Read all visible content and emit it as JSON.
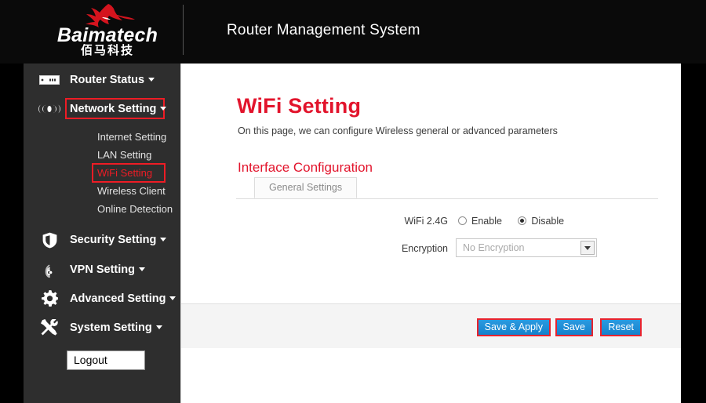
{
  "header": {
    "logo_word": "Baimatech",
    "logo_cn": "佰马科技",
    "logo_icon": "horse-head-icon",
    "title": "Router Management System"
  },
  "sidebar": {
    "groups": [
      {
        "label": "Router Status",
        "icon": "router-device-icon",
        "highlighted": false,
        "has_caret": true
      },
      {
        "label": "Network Setting",
        "icon": "broadcast-signal-icon",
        "highlighted": true,
        "has_caret": true
      },
      {
        "label": "Security Setting",
        "icon": "shield-icon",
        "highlighted": false,
        "has_caret": true
      },
      {
        "label": "VPN Setting",
        "icon": "wifi-waves-icon",
        "highlighted": false,
        "has_caret": true
      },
      {
        "label": "Advanced Setting",
        "icon": "gear-icon",
        "highlighted": false,
        "has_caret": true
      },
      {
        "label": "System Setting",
        "icon": "tools-icon",
        "highlighted": false,
        "has_caret": true
      }
    ],
    "network_submenu": [
      {
        "label": "Internet Setting",
        "active": false
      },
      {
        "label": "LAN Setting",
        "active": false
      },
      {
        "label": "WiFi Setting",
        "active": true
      },
      {
        "label": "Wireless Client",
        "active": false
      },
      {
        "label": "Online Detection",
        "active": false
      }
    ],
    "logout_label": "Logout"
  },
  "main": {
    "page_title": "WiFi Setting",
    "page_subtitle": "On this page, we can configure Wireless general or advanced parameters",
    "section_title": "Interface Configuration",
    "tabs": [
      {
        "label": "General Settings",
        "active": true
      }
    ],
    "fields": {
      "wifi": {
        "label": "WiFi 2.4G",
        "options": [
          {
            "label": "Enable",
            "checked": false
          },
          {
            "label": "Disable",
            "checked": true
          }
        ]
      },
      "encryption": {
        "label": "Encryption",
        "value": "No Encryption",
        "disabled": true
      }
    },
    "buttons": {
      "save_apply": "Save & Apply",
      "save": "Save",
      "reset": "Reset"
    }
  },
  "colors": {
    "brand_red": "#e2142c",
    "highlight_red": "#ee1c25",
    "button_blue": "#1b8ad8",
    "sidebar_bg": "#2e2e2e",
    "header_bg": "#0a0a0a"
  }
}
